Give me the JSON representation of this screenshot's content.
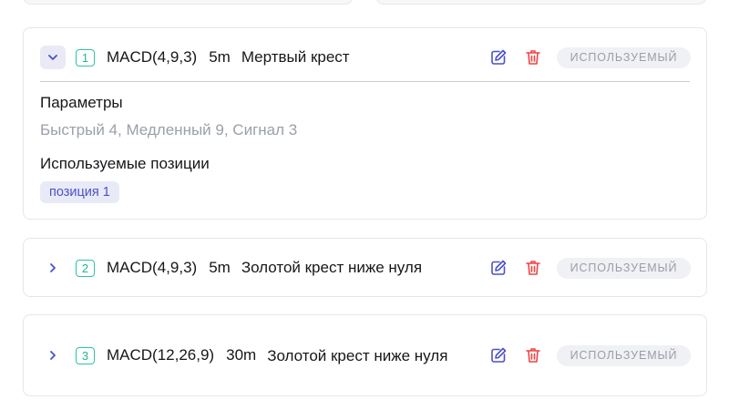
{
  "conditions": [
    {
      "number": "1",
      "indicator": "MACD(4,9,3)",
      "timeframe": "5m",
      "condition": "Мертвый крест",
      "status": "ИСПОЛЬЗУЕМЫЙ",
      "expanded": true,
      "params_label": "Параметры",
      "params_value": "Быстрый 4, Медленный 9, Сигнал 3",
      "positions_label": "Используемые позиции",
      "positions": [
        "позиция 1"
      ]
    },
    {
      "number": "2",
      "indicator": "MACD(4,9,3)",
      "timeframe": "5m",
      "condition": "Золотой крест ниже нуля",
      "status": "ИСПОЛЬЗУЕМЫЙ",
      "expanded": false
    },
    {
      "number": "3",
      "indicator": "MACD(12,26,9)",
      "timeframe": "30m",
      "condition": "Золотой крест ниже нуля",
      "status": "ИСПОЛЬЗУЕМЫЙ",
      "expanded": false
    }
  ],
  "icons": {
    "toggle_open": "chevron-down-icon",
    "toggle_closed": "chevron-right-icon",
    "edit": "pencil-icon",
    "delete": "trash-icon"
  },
  "colors": {
    "accent": "#4c51c6",
    "number_badge": "#22b592",
    "delete": "#ef4444",
    "status_bg": "#f0f1f4",
    "status_text": "#9a9ea8"
  }
}
